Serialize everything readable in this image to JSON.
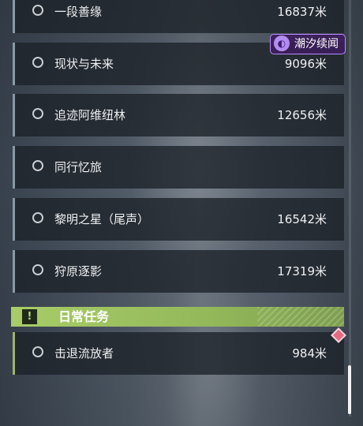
{
  "quests": [
    {
      "name": "一段善缘",
      "distance": "16837米"
    },
    {
      "name": "现状与未来",
      "distance": "9096米"
    },
    {
      "name": "追迹阿维纽林",
      "distance": "12656米"
    },
    {
      "name": "同行忆旅",
      "distance": ""
    },
    {
      "name": "黎明之星（尾声）",
      "distance": "16542米"
    },
    {
      "name": "狩原逐影",
      "distance": "17319米"
    }
  ],
  "daily_section": {
    "icon": "exclamation-icon",
    "icon_glyph": "!",
    "title": "日常任务",
    "color": "#a8cc68"
  },
  "daily_quests": [
    {
      "name": "击退流放者",
      "distance": "984米"
    }
  ],
  "badge": {
    "label": "潮汐续闻",
    "icon": "tide-icon",
    "icon_glyph": "◐",
    "color": "#b889ff"
  },
  "marker": {
    "icon": "diamond-marker-icon",
    "color": "#e56a80"
  }
}
